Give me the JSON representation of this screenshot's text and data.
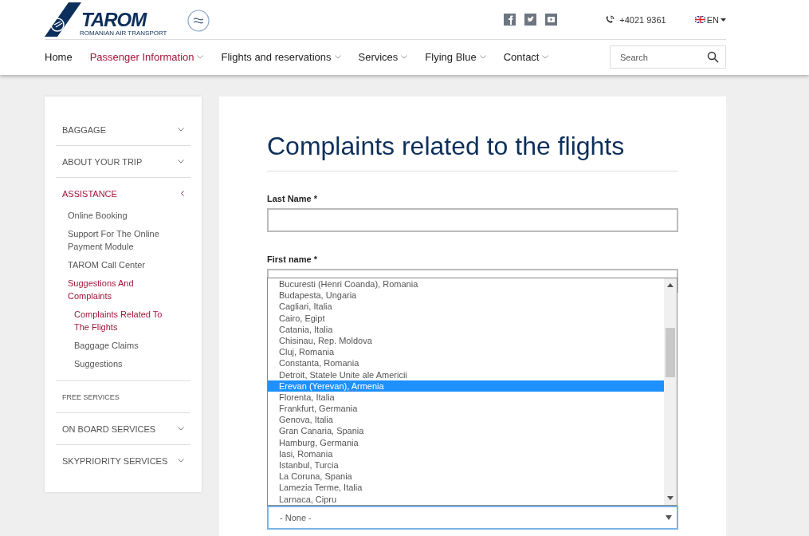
{
  "header": {
    "logo_name": "TAROM",
    "logo_tagline": "ROMANIAN AIR TRANSPORT",
    "phone": "+4021 9361",
    "language": "EN"
  },
  "nav": [
    {
      "label": "Home",
      "selected": false,
      "dropdown": false
    },
    {
      "label": "Passenger Information",
      "selected": true,
      "dropdown": true
    },
    {
      "label": "Flights and reservations",
      "selected": false,
      "dropdown": true
    },
    {
      "label": "Services",
      "selected": false,
      "dropdown": true
    },
    {
      "label": "Flying Blue",
      "selected": false,
      "dropdown": true
    },
    {
      "label": "Contact",
      "selected": false,
      "dropdown": true
    }
  ],
  "search": {
    "placeholder": "Search"
  },
  "sidebar": {
    "items": [
      {
        "label": "BAGGAGE",
        "kind": "section",
        "expanded": false,
        "selected": false
      },
      {
        "label": "ABOUT YOUR TRIP",
        "kind": "section",
        "expanded": false,
        "selected": false
      },
      {
        "label": "ASSISTANCE",
        "kind": "section",
        "expanded": true,
        "selected": true,
        "children": [
          {
            "label": "Online Booking",
            "selected": false
          },
          {
            "label": "Support For The Online Payment Module",
            "selected": false
          },
          {
            "label": "TAROM Call Center",
            "selected": false
          },
          {
            "label": "Suggestions And Complaints",
            "selected": true,
            "children": [
              {
                "label": "Complaints Related To The Flights",
                "selected": true
              },
              {
                "label": "Baggage Claims",
                "selected": false
              },
              {
                "label": "Suggestions",
                "selected": false
              }
            ]
          }
        ]
      },
      {
        "label": "FREE SERVICES",
        "kind": "plain",
        "selected": false
      },
      {
        "label": "ON BOARD SERVICES",
        "kind": "section",
        "expanded": false,
        "selected": false
      },
      {
        "label": "SKYPRIORITY SERVICES",
        "kind": "section",
        "expanded": false,
        "selected": false
      }
    ]
  },
  "main": {
    "title": "Complaints related to the flights",
    "fields": [
      {
        "label": "Last Name *"
      },
      {
        "label": "First name *"
      }
    ],
    "dropdown": {
      "value": "- None -",
      "options": [
        {
          "label": "Bucuresti (Henri Coanda), Romania",
          "selected": false
        },
        {
          "label": "Budapesta, Ungaria",
          "selected": false
        },
        {
          "label": "Cagliari, Italia",
          "selected": false
        },
        {
          "label": "Cairo, Egipt",
          "selected": false
        },
        {
          "label": "Catania, Italia",
          "selected": false
        },
        {
          "label": "Chisinau, Rep. Moldova",
          "selected": false
        },
        {
          "label": "Cluj, Romania",
          "selected": false
        },
        {
          "label": "Constanta, Romania",
          "selected": false
        },
        {
          "label": "Detroit, Statele Unite ale Americii",
          "selected": false
        },
        {
          "label": "Erevan (Yerevan), Armenia",
          "selected": true
        },
        {
          "label": "Florenta, Italia",
          "selected": false
        },
        {
          "label": "Frankfurt, Germania",
          "selected": false
        },
        {
          "label": "Genova, Italia",
          "selected": false
        },
        {
          "label": "Gran Canaria, Spania",
          "selected": false
        },
        {
          "label": "Hamburg, Germania",
          "selected": false
        },
        {
          "label": "Iasi, Romania",
          "selected": false
        },
        {
          "label": "Istanbul, Turcia",
          "selected": false
        },
        {
          "label": "La Coruna, Spania",
          "selected": false
        },
        {
          "label": "Lamezia Terme, Italia",
          "selected": false
        },
        {
          "label": "Larnaca, Cipru",
          "selected": false
        }
      ]
    }
  }
}
